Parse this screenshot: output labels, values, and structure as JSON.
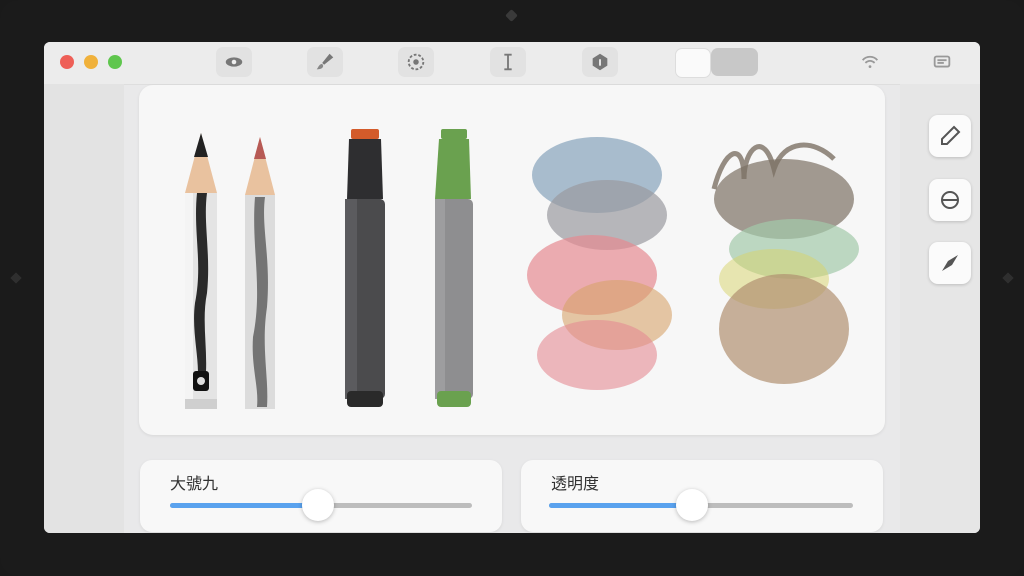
{
  "window": {
    "traffic_lights": {
      "close": "#ee5f57",
      "minimize": "#f0b13b",
      "zoom": "#5fc64d"
    },
    "toolbar_icons": [
      "eye-icon",
      "brush-icon",
      "settings-icon",
      "text-cursor-icon",
      "fill-bucket-icon",
      "wifi-icon",
      "notes-icon"
    ]
  },
  "canvas": {
    "tools": [
      {
        "name": "pencil-black",
        "color": "#222222"
      },
      {
        "name": "pencil-red",
        "color": "#b75a55"
      },
      {
        "name": "marker-dark",
        "cap": "#d35b2a",
        "color": "#4b4b4d"
      },
      {
        "name": "marker-green",
        "cap": "#6aa14f",
        "color": "#8e8e90"
      },
      {
        "name": "watercolor-swatch-1",
        "colors": [
          "#8da8bf",
          "#e58a92",
          "#d7a36b"
        ]
      },
      {
        "name": "watercolor-swatch-2",
        "colors": [
          "#7c7064",
          "#a3c9a9",
          "#d8b46a"
        ]
      }
    ]
  },
  "right_rail": [
    "pencil-icon",
    "eraser-icon",
    "pen-nib-icon"
  ],
  "sliders": [
    {
      "label": "大號九",
      "value": 0.49
    },
    {
      "label": "透明度",
      "value": 0.47
    }
  ]
}
